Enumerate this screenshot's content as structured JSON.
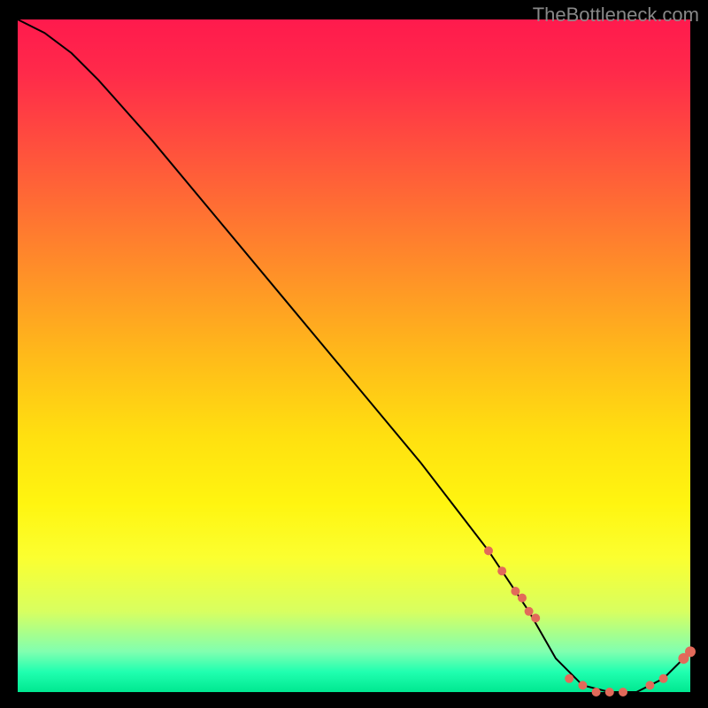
{
  "watermark": "TheBottleneck.com",
  "chart_data": {
    "type": "line",
    "title": "",
    "xlabel": "",
    "ylabel": "",
    "xlim": [
      0,
      100
    ],
    "ylim": [
      0,
      100
    ],
    "x": [
      0,
      4,
      8,
      12,
      20,
      30,
      40,
      50,
      60,
      70,
      76,
      80,
      84,
      88,
      92,
      96,
      100
    ],
    "values": [
      100,
      98,
      95,
      91,
      82,
      70,
      58,
      46,
      34,
      21,
      12,
      5,
      1,
      0,
      0,
      2,
      6
    ],
    "series": [
      {
        "name": "points",
        "x": [
          70,
          72,
          74,
          75,
          76,
          77,
          82,
          84,
          86,
          88,
          90,
          94,
          96,
          99,
          100
        ],
        "values": [
          21,
          18,
          15,
          14,
          12,
          11,
          2,
          1,
          0,
          0,
          0,
          1,
          2,
          5,
          6
        ]
      }
    ]
  }
}
